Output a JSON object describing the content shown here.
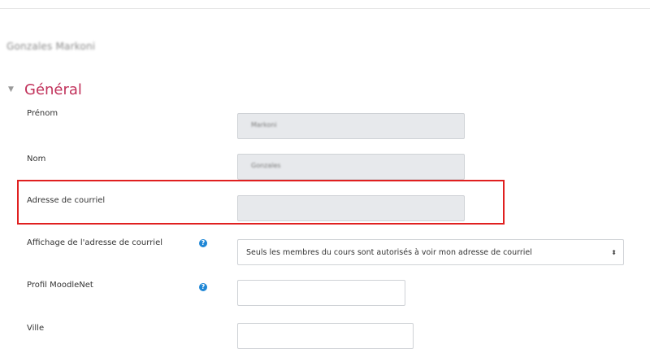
{
  "profile": {
    "full_name": "Gonzales Markoni"
  },
  "section": {
    "title": "Général",
    "toggle_icon": "chevron-down-icon"
  },
  "fields": {
    "firstname": {
      "label": "Prénom",
      "value": "Markoni"
    },
    "lastname": {
      "label": "Nom",
      "value": "Gonzales"
    },
    "email": {
      "label": "Adresse de courriel",
      "value": ""
    },
    "email_display": {
      "label": "Affichage de l'adresse de courriel",
      "selected": "Seuls les membres du cours sont autorisés à voir mon adresse de courriel"
    },
    "moodlenet": {
      "label": "Profil MoodleNet",
      "value": ""
    },
    "city": {
      "label": "Ville",
      "value": ""
    }
  },
  "colors": {
    "accent": "#c1315a",
    "highlight": "#e02020",
    "help": "#1f87d6"
  }
}
